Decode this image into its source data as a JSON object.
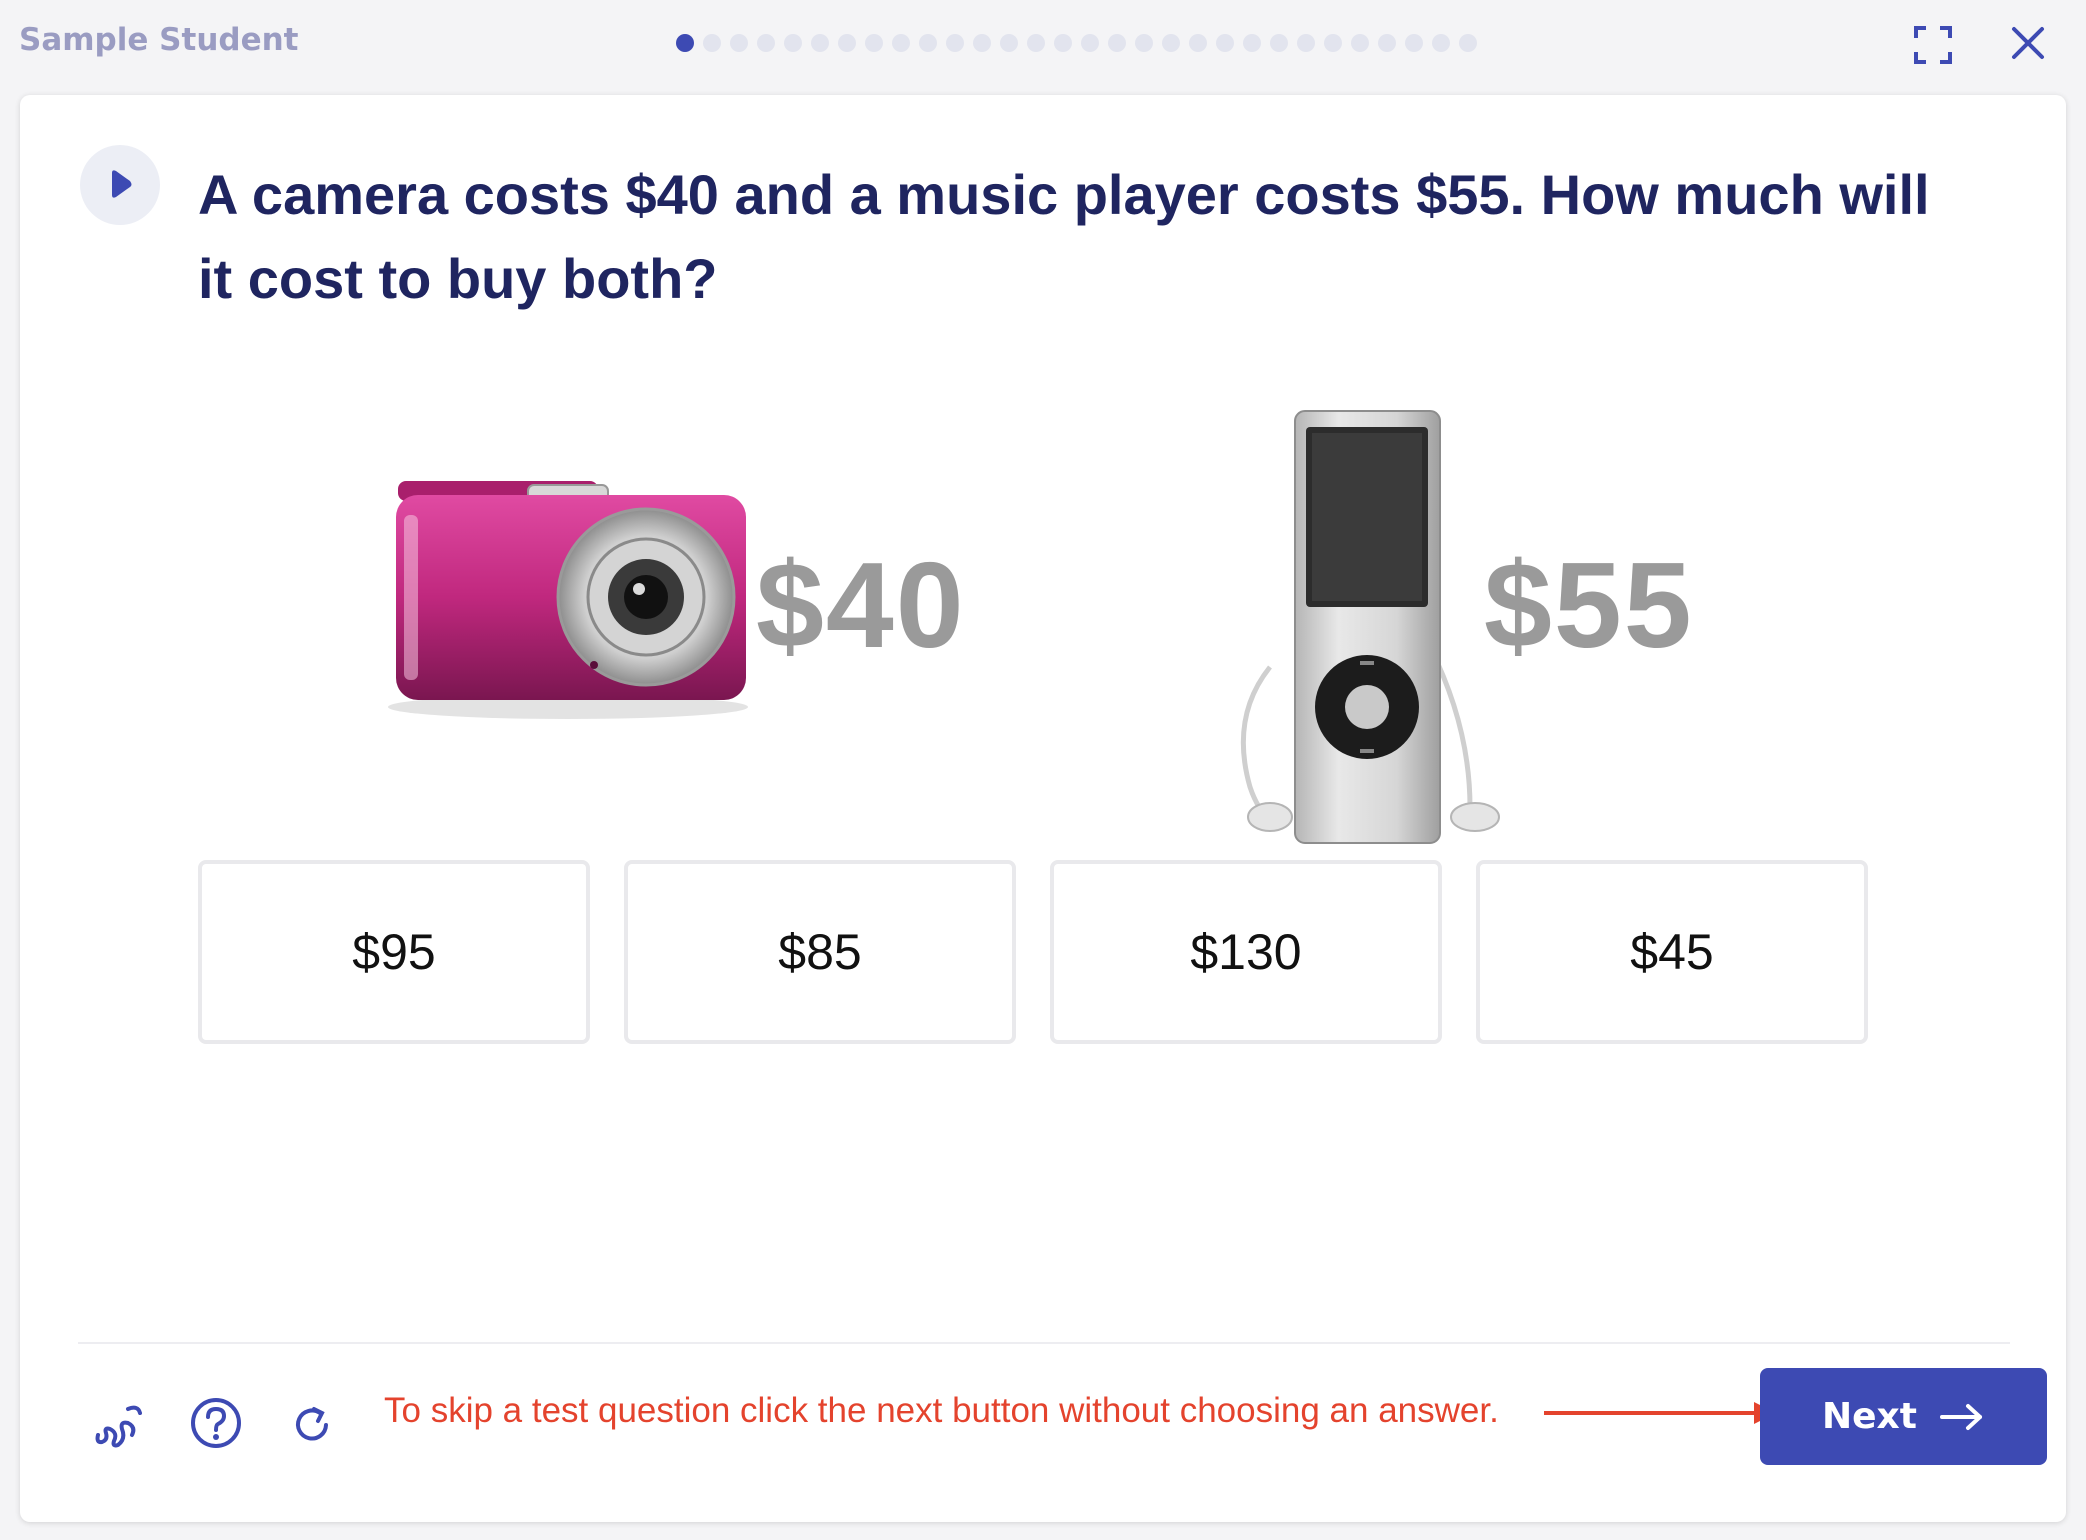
{
  "header": {
    "student_name": "Sample Student",
    "progress": {
      "current": 1,
      "total": 30
    }
  },
  "question": {
    "text": "A camera costs $40 and a music player costs $55. How much will it cost to buy both?"
  },
  "products": [
    {
      "name": "camera",
      "price": "$40",
      "color": "#c0287e"
    },
    {
      "name": "music player",
      "price": "$55",
      "color": "#c8c8c8"
    }
  ],
  "choices": [
    "$95",
    "$85",
    "$130",
    "$45"
  ],
  "footer": {
    "skip_note": "To skip a test question click the next button without choosing an answer.",
    "next_label": "Next"
  },
  "colors": {
    "accent": "#3d4ab3",
    "question_text": "#1f2560",
    "note": "#e4432d"
  }
}
